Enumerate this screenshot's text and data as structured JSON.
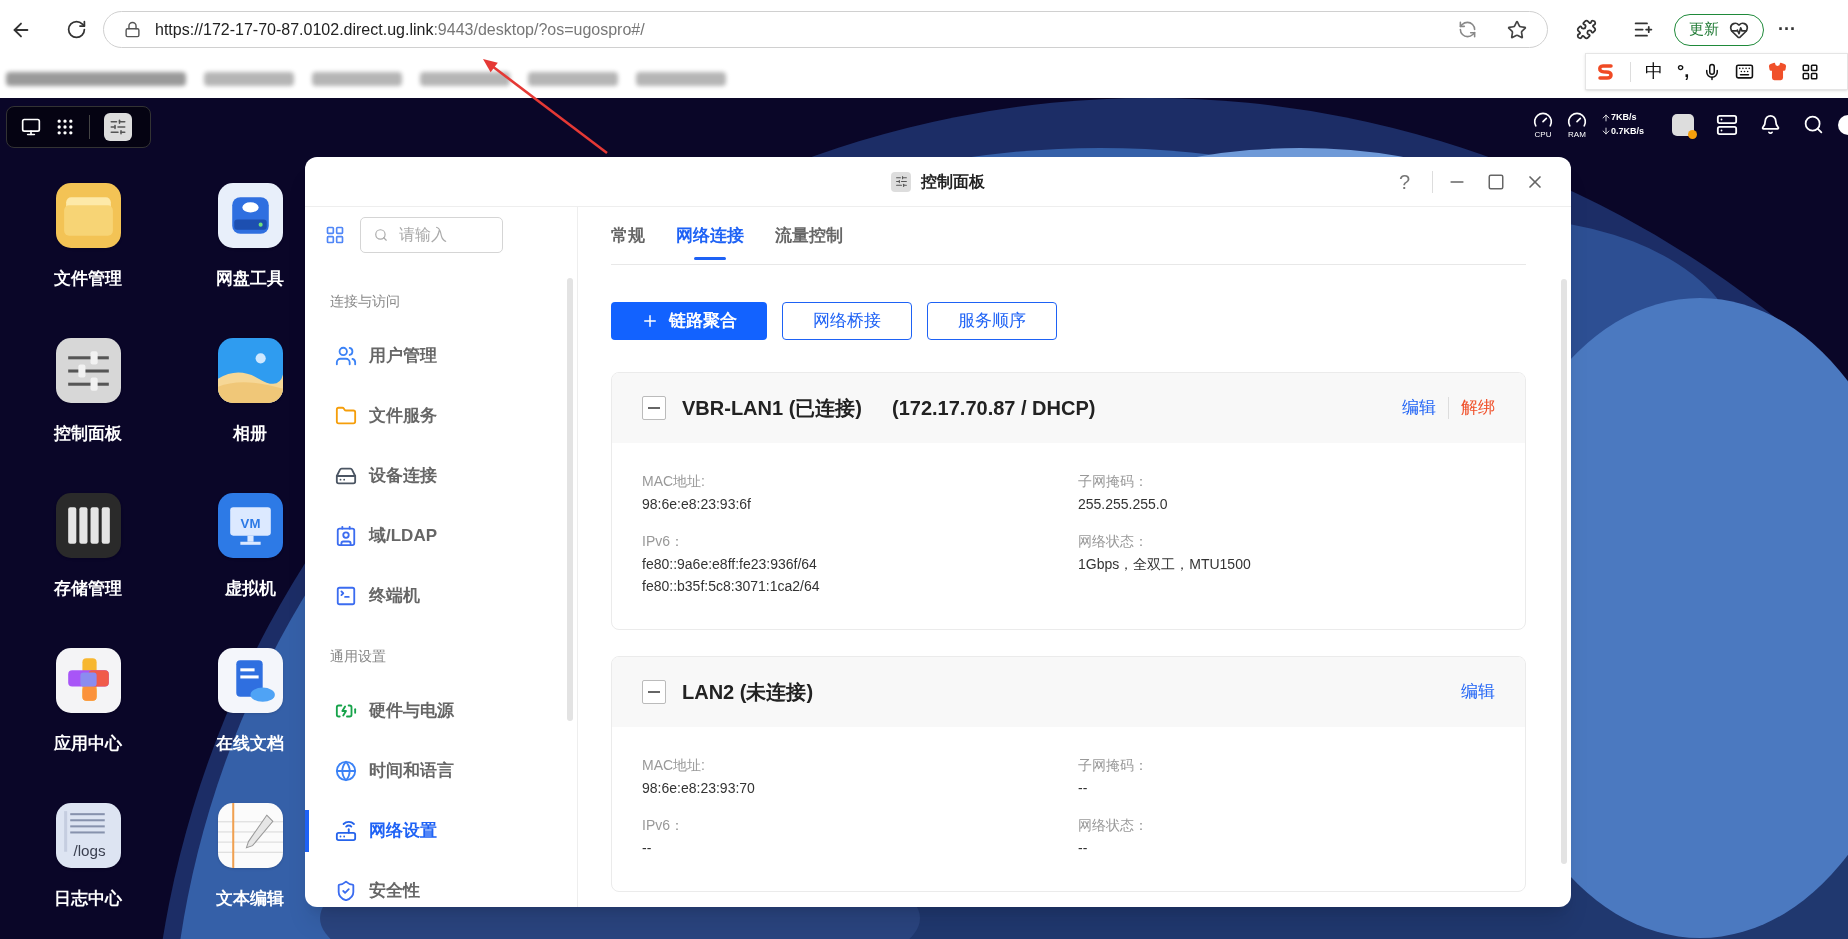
{
  "browser": {
    "url_host": "https://172-17-70-87.0102.direct.ug.link",
    "url_rest": ":9443/desktop/?os=ugospro#/",
    "update_label": "更新",
    "more_label": "···"
  },
  "ime_bar": {
    "mode": "中",
    "punctuation": "°,"
  },
  "tray": {
    "cpu_label": "CPU",
    "ram_label": "RAM",
    "upload": "7KB/s",
    "download": "0.7KB/s"
  },
  "desktop_icons": [
    {
      "label": "文件管理",
      "kind": "folder"
    },
    {
      "label": "控制面板",
      "kind": "sliders"
    },
    {
      "label": "存储管理",
      "kind": "storage"
    },
    {
      "label": "应用中心",
      "kind": "apps"
    },
    {
      "label": "日志中心",
      "kind": "logs",
      "icon_text": "/logs"
    },
    {
      "label": "网盘工具",
      "kind": "drive"
    },
    {
      "label": "相册",
      "kind": "photos"
    },
    {
      "label": "虚拟机",
      "kind": "vm",
      "icon_text": "VM"
    },
    {
      "label": "在线文档",
      "kind": "doc"
    },
    {
      "label": "文本编辑",
      "kind": "notepad"
    }
  ],
  "window": {
    "title": "控制面板",
    "help": "?"
  },
  "sidebar": {
    "search_placeholder": "请输入",
    "sections": [
      {
        "title": "连接与访问",
        "items": [
          {
            "label": "用户管理",
            "kind": "users",
            "selected": false
          },
          {
            "label": "文件服务",
            "kind": "folder",
            "selected": false
          },
          {
            "label": "设备连接",
            "kind": "device",
            "selected": false
          },
          {
            "label": "域/LDAP",
            "kind": "card",
            "selected": false
          },
          {
            "label": "终端机",
            "kind": "terminal",
            "selected": false
          }
        ]
      },
      {
        "title": "通用设置",
        "items": [
          {
            "label": "硬件与电源",
            "kind": "battery",
            "selected": false
          },
          {
            "label": "时间和语言",
            "kind": "globe",
            "selected": false
          },
          {
            "label": "网络设置",
            "kind": "router",
            "selected": true
          },
          {
            "label": "安全性",
            "kind": "shield",
            "selected": false
          }
        ]
      }
    ]
  },
  "tabs": [
    {
      "label": "常规",
      "selected": false
    },
    {
      "label": "网络连接",
      "selected": true
    },
    {
      "label": "流量控制",
      "selected": false
    }
  ],
  "actions": [
    {
      "label": "链路聚合",
      "kind": "primary"
    },
    {
      "label": "网络桥接",
      "kind": "outline"
    },
    {
      "label": "服务顺序",
      "kind": "outline"
    }
  ],
  "interfaces": [
    {
      "name": "VBR-LAN1 (已连接)",
      "address": "(172.17.70.87 / DHCP)",
      "expanded": true,
      "links": [
        {
          "label": "编辑",
          "kind": "edit"
        },
        {
          "label": "解绑",
          "kind": "unbind"
        }
      ],
      "fields": [
        {
          "label": "MAC地址:",
          "values": [
            "98:6e:e8:23:93:6f"
          ]
        },
        {
          "label": "子网掩码：",
          "values": [
            "255.255.255.0"
          ]
        },
        {
          "label": "IPv6：",
          "values": [
            "fe80::9a6e:e8ff:fe23:936f/64",
            "fe80::b35f:5c8:3071:1ca2/64"
          ]
        },
        {
          "label": "网络状态：",
          "values": [
            "1Gbps，全双工，MTU1500"
          ]
        }
      ]
    },
    {
      "name": "LAN2 (未连接)",
      "expanded": true,
      "links": [
        {
          "label": "编辑",
          "kind": "edit"
        }
      ],
      "fields": [
        {
          "label": "MAC地址:",
          "values": [
            "98:6e:e8:23:93:70"
          ]
        },
        {
          "label": "子网掩码：",
          "values": [
            "--"
          ]
        },
        {
          "label": "IPv6：",
          "values": [
            "--"
          ]
        },
        {
          "label": "网络状态：",
          "values": [
            "--"
          ]
        }
      ]
    }
  ]
}
